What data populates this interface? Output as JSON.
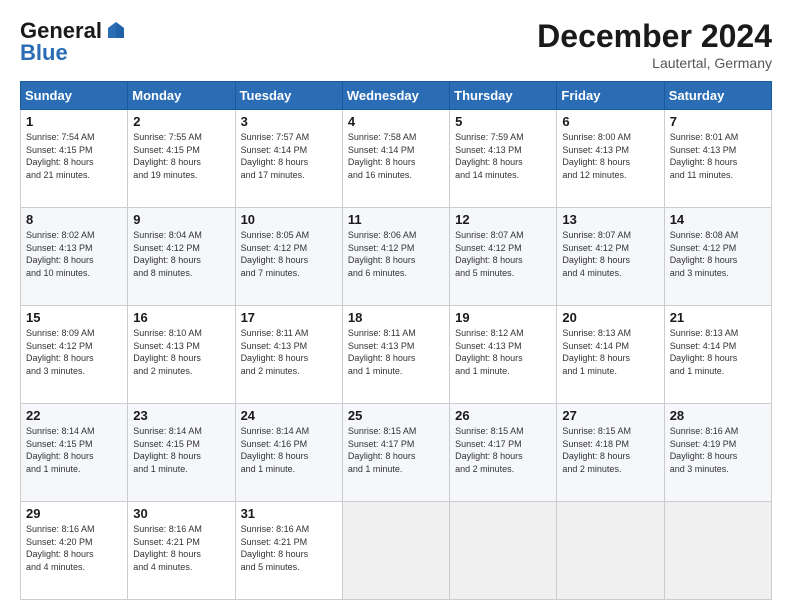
{
  "header": {
    "logo_general": "General",
    "logo_blue": "Blue",
    "month_title": "December 2024",
    "location": "Lautertal, Germany"
  },
  "days_of_week": [
    "Sunday",
    "Monday",
    "Tuesday",
    "Wednesday",
    "Thursday",
    "Friday",
    "Saturday"
  ],
  "weeks": [
    [
      {
        "day": "1",
        "lines": [
          "Sunrise: 7:54 AM",
          "Sunset: 4:15 PM",
          "Daylight: 8 hours",
          "and 21 minutes."
        ]
      },
      {
        "day": "2",
        "lines": [
          "Sunrise: 7:55 AM",
          "Sunset: 4:15 PM",
          "Daylight: 8 hours",
          "and 19 minutes."
        ]
      },
      {
        "day": "3",
        "lines": [
          "Sunrise: 7:57 AM",
          "Sunset: 4:14 PM",
          "Daylight: 8 hours",
          "and 17 minutes."
        ]
      },
      {
        "day": "4",
        "lines": [
          "Sunrise: 7:58 AM",
          "Sunset: 4:14 PM",
          "Daylight: 8 hours",
          "and 16 minutes."
        ]
      },
      {
        "day": "5",
        "lines": [
          "Sunrise: 7:59 AM",
          "Sunset: 4:13 PM",
          "Daylight: 8 hours",
          "and 14 minutes."
        ]
      },
      {
        "day": "6",
        "lines": [
          "Sunrise: 8:00 AM",
          "Sunset: 4:13 PM",
          "Daylight: 8 hours",
          "and 12 minutes."
        ]
      },
      {
        "day": "7",
        "lines": [
          "Sunrise: 8:01 AM",
          "Sunset: 4:13 PM",
          "Daylight: 8 hours",
          "and 11 minutes."
        ]
      }
    ],
    [
      {
        "day": "8",
        "lines": [
          "Sunrise: 8:02 AM",
          "Sunset: 4:13 PM",
          "Daylight: 8 hours",
          "and 10 minutes."
        ]
      },
      {
        "day": "9",
        "lines": [
          "Sunrise: 8:04 AM",
          "Sunset: 4:12 PM",
          "Daylight: 8 hours",
          "and 8 minutes."
        ]
      },
      {
        "day": "10",
        "lines": [
          "Sunrise: 8:05 AM",
          "Sunset: 4:12 PM",
          "Daylight: 8 hours",
          "and 7 minutes."
        ]
      },
      {
        "day": "11",
        "lines": [
          "Sunrise: 8:06 AM",
          "Sunset: 4:12 PM",
          "Daylight: 8 hours",
          "and 6 minutes."
        ]
      },
      {
        "day": "12",
        "lines": [
          "Sunrise: 8:07 AM",
          "Sunset: 4:12 PM",
          "Daylight: 8 hours",
          "and 5 minutes."
        ]
      },
      {
        "day": "13",
        "lines": [
          "Sunrise: 8:07 AM",
          "Sunset: 4:12 PM",
          "Daylight: 8 hours",
          "and 4 minutes."
        ]
      },
      {
        "day": "14",
        "lines": [
          "Sunrise: 8:08 AM",
          "Sunset: 4:12 PM",
          "Daylight: 8 hours",
          "and 3 minutes."
        ]
      }
    ],
    [
      {
        "day": "15",
        "lines": [
          "Sunrise: 8:09 AM",
          "Sunset: 4:12 PM",
          "Daylight: 8 hours",
          "and 3 minutes."
        ]
      },
      {
        "day": "16",
        "lines": [
          "Sunrise: 8:10 AM",
          "Sunset: 4:13 PM",
          "Daylight: 8 hours",
          "and 2 minutes."
        ]
      },
      {
        "day": "17",
        "lines": [
          "Sunrise: 8:11 AM",
          "Sunset: 4:13 PM",
          "Daylight: 8 hours",
          "and 2 minutes."
        ]
      },
      {
        "day": "18",
        "lines": [
          "Sunrise: 8:11 AM",
          "Sunset: 4:13 PM",
          "Daylight: 8 hours",
          "and 1 minute."
        ]
      },
      {
        "day": "19",
        "lines": [
          "Sunrise: 8:12 AM",
          "Sunset: 4:13 PM",
          "Daylight: 8 hours",
          "and 1 minute."
        ]
      },
      {
        "day": "20",
        "lines": [
          "Sunrise: 8:13 AM",
          "Sunset: 4:14 PM",
          "Daylight: 8 hours",
          "and 1 minute."
        ]
      },
      {
        "day": "21",
        "lines": [
          "Sunrise: 8:13 AM",
          "Sunset: 4:14 PM",
          "Daylight: 8 hours",
          "and 1 minute."
        ]
      }
    ],
    [
      {
        "day": "22",
        "lines": [
          "Sunrise: 8:14 AM",
          "Sunset: 4:15 PM",
          "Daylight: 8 hours",
          "and 1 minute."
        ]
      },
      {
        "day": "23",
        "lines": [
          "Sunrise: 8:14 AM",
          "Sunset: 4:15 PM",
          "Daylight: 8 hours",
          "and 1 minute."
        ]
      },
      {
        "day": "24",
        "lines": [
          "Sunrise: 8:14 AM",
          "Sunset: 4:16 PM",
          "Daylight: 8 hours",
          "and 1 minute."
        ]
      },
      {
        "day": "25",
        "lines": [
          "Sunrise: 8:15 AM",
          "Sunset: 4:17 PM",
          "Daylight: 8 hours",
          "and 1 minute."
        ]
      },
      {
        "day": "26",
        "lines": [
          "Sunrise: 8:15 AM",
          "Sunset: 4:17 PM",
          "Daylight: 8 hours",
          "and 2 minutes."
        ]
      },
      {
        "day": "27",
        "lines": [
          "Sunrise: 8:15 AM",
          "Sunset: 4:18 PM",
          "Daylight: 8 hours",
          "and 2 minutes."
        ]
      },
      {
        "day": "28",
        "lines": [
          "Sunrise: 8:16 AM",
          "Sunset: 4:19 PM",
          "Daylight: 8 hours",
          "and 3 minutes."
        ]
      }
    ],
    [
      {
        "day": "29",
        "lines": [
          "Sunrise: 8:16 AM",
          "Sunset: 4:20 PM",
          "Daylight: 8 hours",
          "and 4 minutes."
        ]
      },
      {
        "day": "30",
        "lines": [
          "Sunrise: 8:16 AM",
          "Sunset: 4:21 PM",
          "Daylight: 8 hours",
          "and 4 minutes."
        ]
      },
      {
        "day": "31",
        "lines": [
          "Sunrise: 8:16 AM",
          "Sunset: 4:21 PM",
          "Daylight: 8 hours",
          "and 5 minutes."
        ]
      },
      {
        "day": "",
        "lines": []
      },
      {
        "day": "",
        "lines": []
      },
      {
        "day": "",
        "lines": []
      },
      {
        "day": "",
        "lines": []
      }
    ]
  ]
}
